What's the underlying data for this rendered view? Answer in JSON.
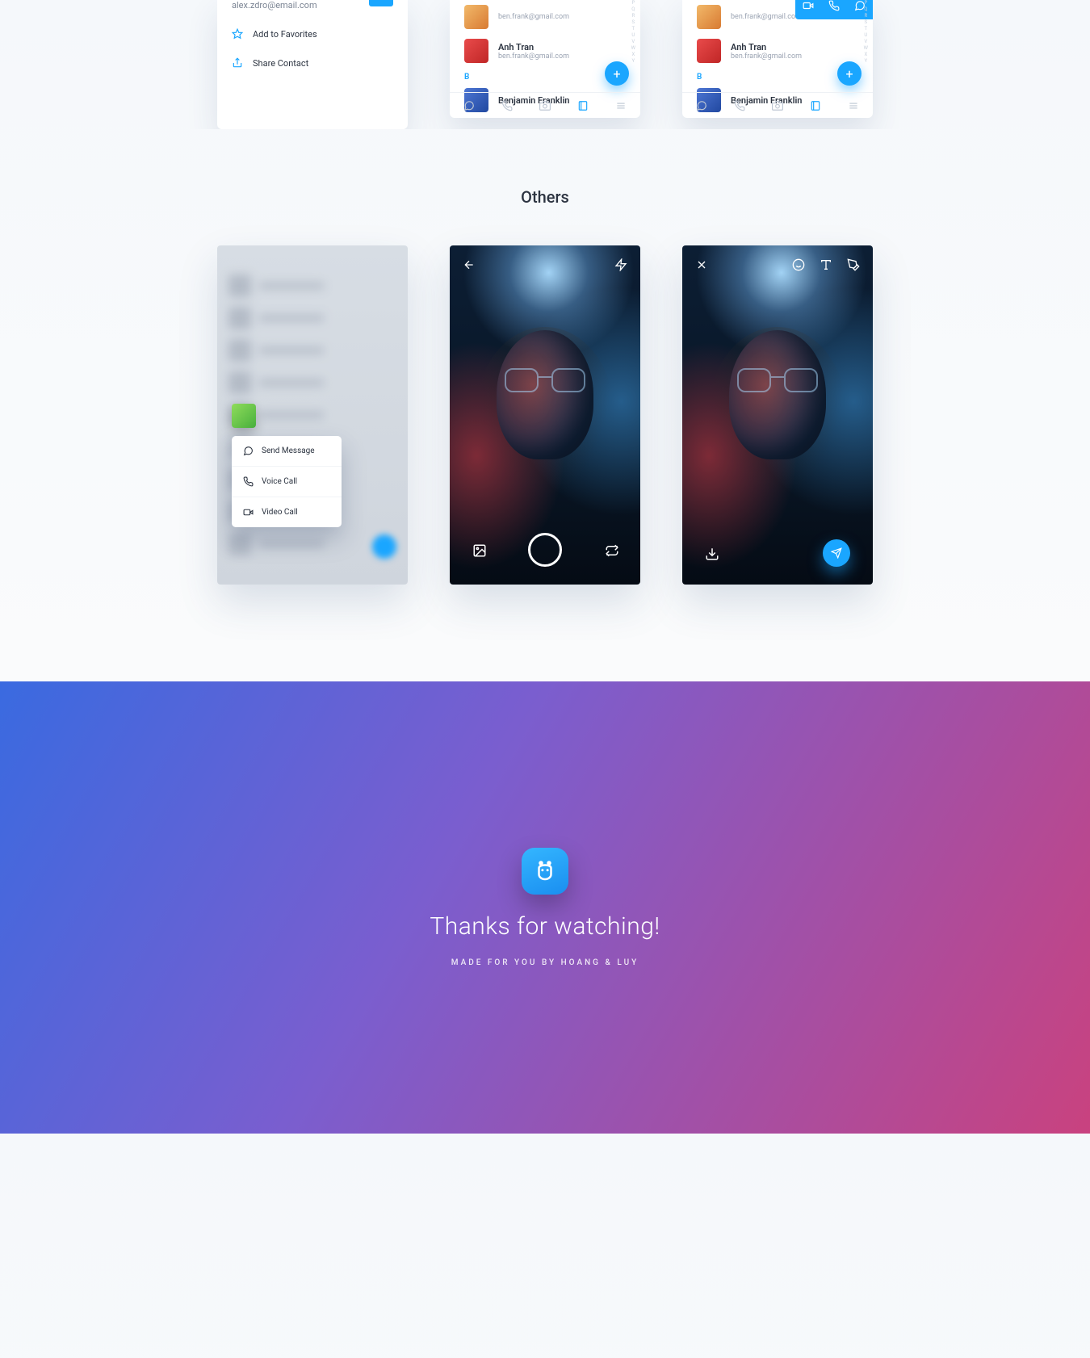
{
  "top": {
    "screenA": {
      "email": "alex.zdro@email.com",
      "options": [
        {
          "icon": "star-icon",
          "label": "Add to Favorites"
        },
        {
          "icon": "share-icon",
          "label": "Share Contact"
        }
      ]
    },
    "screenB": {
      "contacts": [
        {
          "name": "",
          "email": "ben.frank@gmail.com"
        },
        {
          "name": "Anh Tran",
          "email": "ben.frank@gmail.com"
        }
      ],
      "section_letter": "B",
      "next_contact": "Benjamin Franklin",
      "alpha_index": "P\nQ\nR\nS\nT\nU\nV\nW\nX\nY"
    },
    "screenC": {
      "contacts": [
        {
          "name": "",
          "email": "ben.frank@gmail.com"
        },
        {
          "name": "Anh Tran",
          "email": "ben.frank@gmail.com"
        }
      ],
      "section_letter": "B",
      "next_contact": "Benjamin Franklin",
      "alpha_index": "P\nQ\nR\nS\nT\nU\nV\nW\nX\nY"
    }
  },
  "section_title": "Others",
  "mid": {
    "menu": {
      "items": [
        {
          "icon": "message-icon",
          "label": "Send Message"
        },
        {
          "icon": "phone-icon",
          "label": "Voice Call"
        },
        {
          "icon": "video-icon",
          "label": "Video Call"
        }
      ]
    }
  },
  "footer": {
    "title": "Thanks for watching!",
    "subtitle": "MADE FOR YOU BY HOANG & LUY"
  },
  "colors": {
    "accent": "#1aa6ff"
  }
}
